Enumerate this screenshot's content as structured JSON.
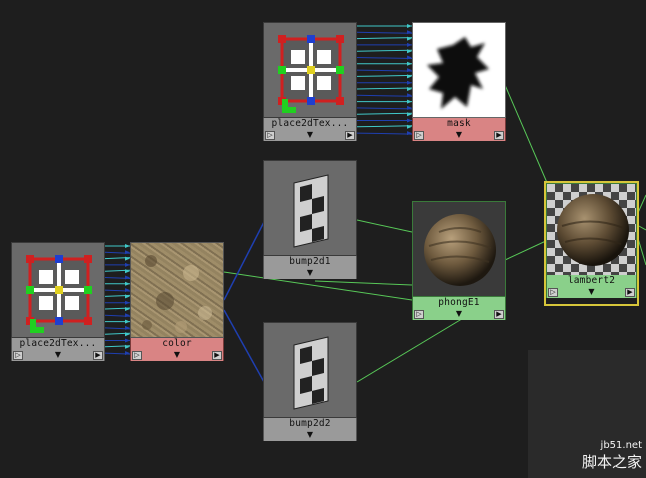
{
  "nodes": {
    "place2d_top": {
      "label": "place2dTex...",
      "type": "place2dTexture"
    },
    "mask": {
      "label": "mask",
      "type": "file"
    },
    "bump2d1": {
      "label": "bump2d1",
      "type": "bump2d"
    },
    "place2d_left": {
      "label": "place2dTex...",
      "type": "place2dTexture"
    },
    "color": {
      "label": "color",
      "type": "file"
    },
    "phongE1": {
      "label": "phongE1",
      "type": "phongE"
    },
    "bump2d2": {
      "label": "bump2d2",
      "type": "bump2d"
    },
    "lambert2": {
      "label": "lambert2",
      "type": "lambert",
      "selected": true
    }
  },
  "port_glyphs": {
    "left": "▷",
    "mid": "▼",
    "right": "▶"
  },
  "colors": {
    "background": "#1e1e1e",
    "utility_node": "#9a9a9a",
    "texture_node": "#d98484",
    "shader_node": "#8ad08a",
    "connection_green": "#58c858",
    "connection_blue": "#1f3fb0",
    "connection_cyan": "#40c8c8",
    "selection": "#d7c53a"
  },
  "watermark": {
    "url": "jb51.net",
    "text": "脚本之家"
  }
}
